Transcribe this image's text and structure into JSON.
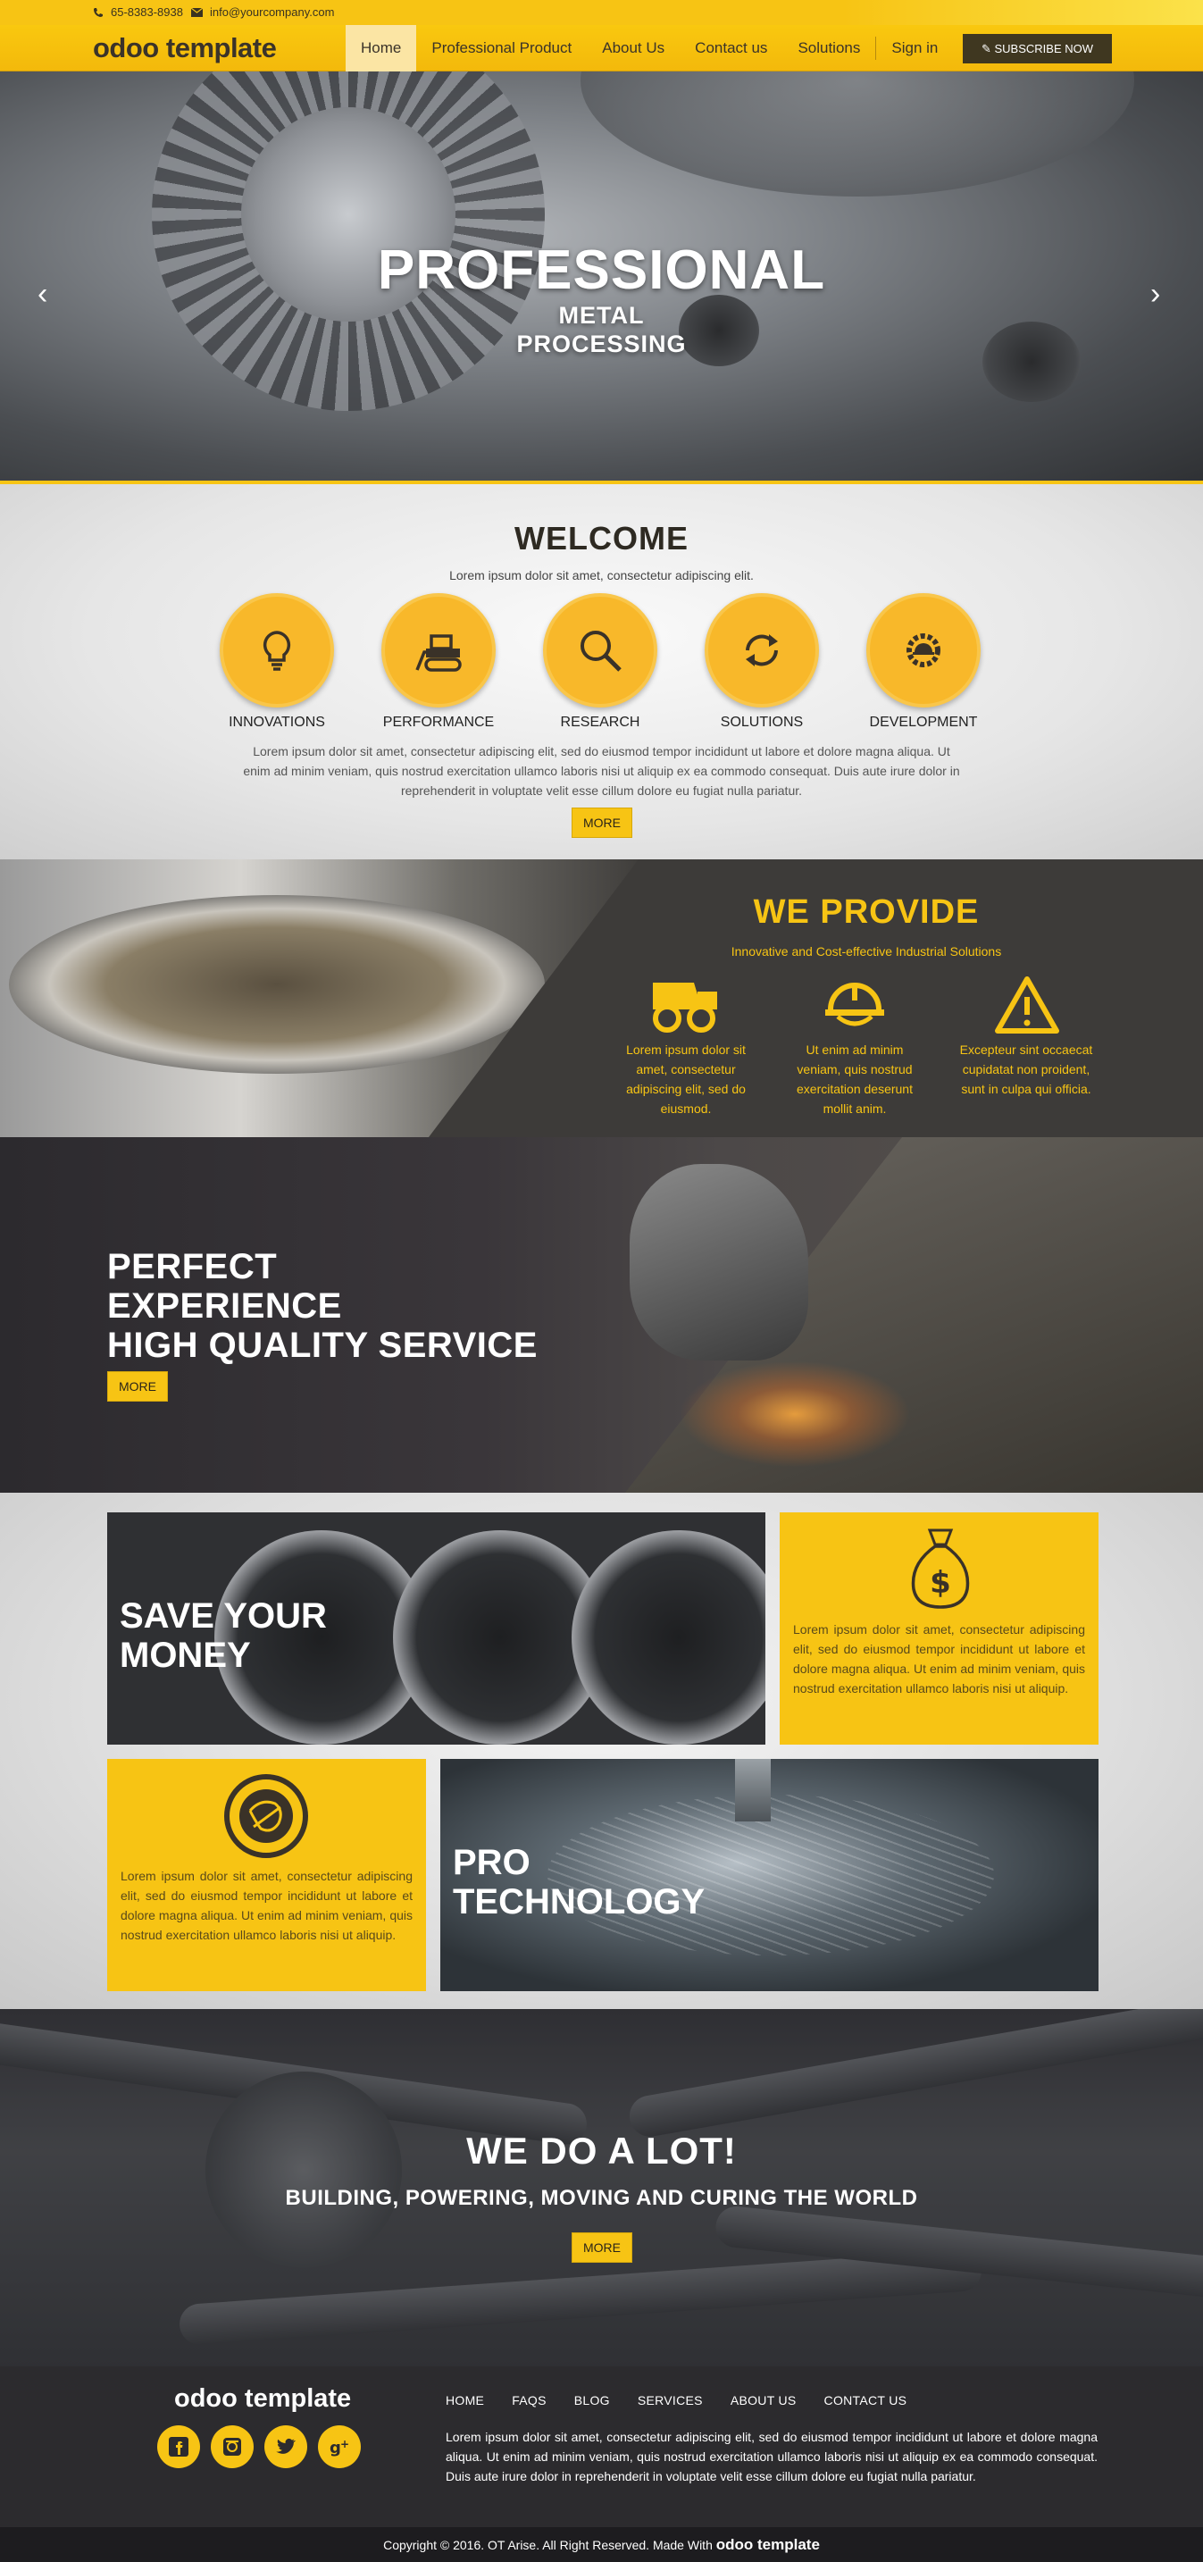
{
  "topbar": {
    "phone": "65-8383-8938",
    "email": "info@yourcompany.com"
  },
  "nav": {
    "logo_main": "odoo",
    "logo_sub": "template",
    "items": [
      {
        "label": "Home"
      },
      {
        "label": "Professional Product"
      },
      {
        "label": "About Us"
      },
      {
        "label": "Contact us"
      },
      {
        "label": "Solutions"
      },
      {
        "label": "Sign in"
      }
    ],
    "subscribe_label": "SUBSCRIBE NOW"
  },
  "hero": {
    "title": "PROFESSIONAL",
    "subtitle_line1": "METAL",
    "subtitle_line2": "PROCESSING",
    "prev_icon": "chevron-left-icon",
    "next_icon": "chevron-right-icon"
  },
  "welcome": {
    "title": "WELCOME",
    "lead": "Lorem ipsum dolor sit amet, consectetur adipiscing elit.",
    "features": [
      {
        "label": "INNOVATIONS",
        "icon": "lightbulb-icon"
      },
      {
        "label": "PERFORMANCE",
        "icon": "bulldozer-icon"
      },
      {
        "label": "RESEARCH",
        "icon": "magnifier-icon"
      },
      {
        "label": "SOLUTIONS",
        "icon": "refresh-icon"
      },
      {
        "label": "DEVELOPMENT",
        "icon": "gear-helmet-icon"
      }
    ],
    "paragraph": "Lorem ipsum dolor sit amet, consectetur adipiscing elit, sed do eiusmod tempor incididunt ut labore et dolore magna aliqua. Ut enim ad minim veniam, quis nostrud exercitation ullamco laboris nisi ut aliquip ex ea commodo consequat. Duis aute irure dolor in reprehenderit in voluptate velit esse cillum dolore eu fugiat nulla pariatur.",
    "more_label": "MORE"
  },
  "provide": {
    "title": "WE PROVIDE",
    "tagline": "Innovative and Cost-effective Industrial Solutions",
    "items": [
      {
        "icon": "dump-truck-icon",
        "text": "Lorem ipsum dolor sit amet, consectetur adipiscing elit, sed do eiusmod."
      },
      {
        "icon": "hard-hat-icon",
        "text": "Ut enim ad minim veniam, quis nostrud exercitation deserunt mollit anim."
      },
      {
        "icon": "warning-icon",
        "text": "Excepteur sint occaecat cupidatat non proident, sunt in culpa qui officia."
      }
    ]
  },
  "perfect": {
    "line1": "PERFECT",
    "line2": "EXPERIENCE",
    "line3": "HIGH QUALITY SERVICE",
    "more_label": "MORE"
  },
  "tiles": {
    "save_line1": "SAVE YOUR",
    "save_line2": "MONEY",
    "money_icon": "money-bag-icon",
    "money_text": "Lorem ipsum dolor sit amet, consectetur adipiscing elit, sed do eiusmod tempor incididunt ut labore et dolore magna aliqua. Ut enim ad minim veniam, quis nostrud exercitation ullamco laboris nisi ut aliquip.",
    "globe_icon": "globe-icon",
    "globe_text": "Lorem ipsum dolor sit amet, consectetur adipiscing elit, sed do eiusmod tempor incididunt ut labore et dolore magna aliqua. Ut enim ad minim veniam, quis nostrud exercitation ullamco laboris nisi ut aliquip.",
    "pro_line1": "PRO",
    "pro_line2": "TECHNOLOGY"
  },
  "wedo": {
    "title": "WE DO A LOT!",
    "subtitle": "BUILDING, POWERING, MOVING AND CURING THE WORLD",
    "more_label": "MORE"
  },
  "footer": {
    "logo_main": "odoo",
    "logo_sub": "template",
    "social": [
      {
        "icon": "facebook-icon"
      },
      {
        "icon": "instagram-icon"
      },
      {
        "icon": "twitter-icon"
      },
      {
        "icon": "google-plus-icon"
      }
    ],
    "menu": [
      "HOME",
      "FAQS",
      "BLOG",
      "SERVICES",
      "ABOUT US",
      "CONTACT US"
    ],
    "text": "Lorem ipsum dolor sit amet, consectetur adipiscing elit, sed do eiusmod tempor incididunt ut labore et dolore magna aliqua. Ut enim ad minim veniam, quis nostrud exercitation ullamco laboris nisi ut aliquip ex ea commodo consequat. Duis aute irure dolor in reprehenderit in voluptate velit esse cillum dolore eu fugiat nulla pariatur.",
    "copyright": "Copyright © 2016. OT Arise. All Right Reserved. Made With",
    "copyright_logo": "odoo template"
  },
  "colors": {
    "accent": "#f7c414",
    "dark": "#3d3b39",
    "footer": "#2c2b2e"
  }
}
